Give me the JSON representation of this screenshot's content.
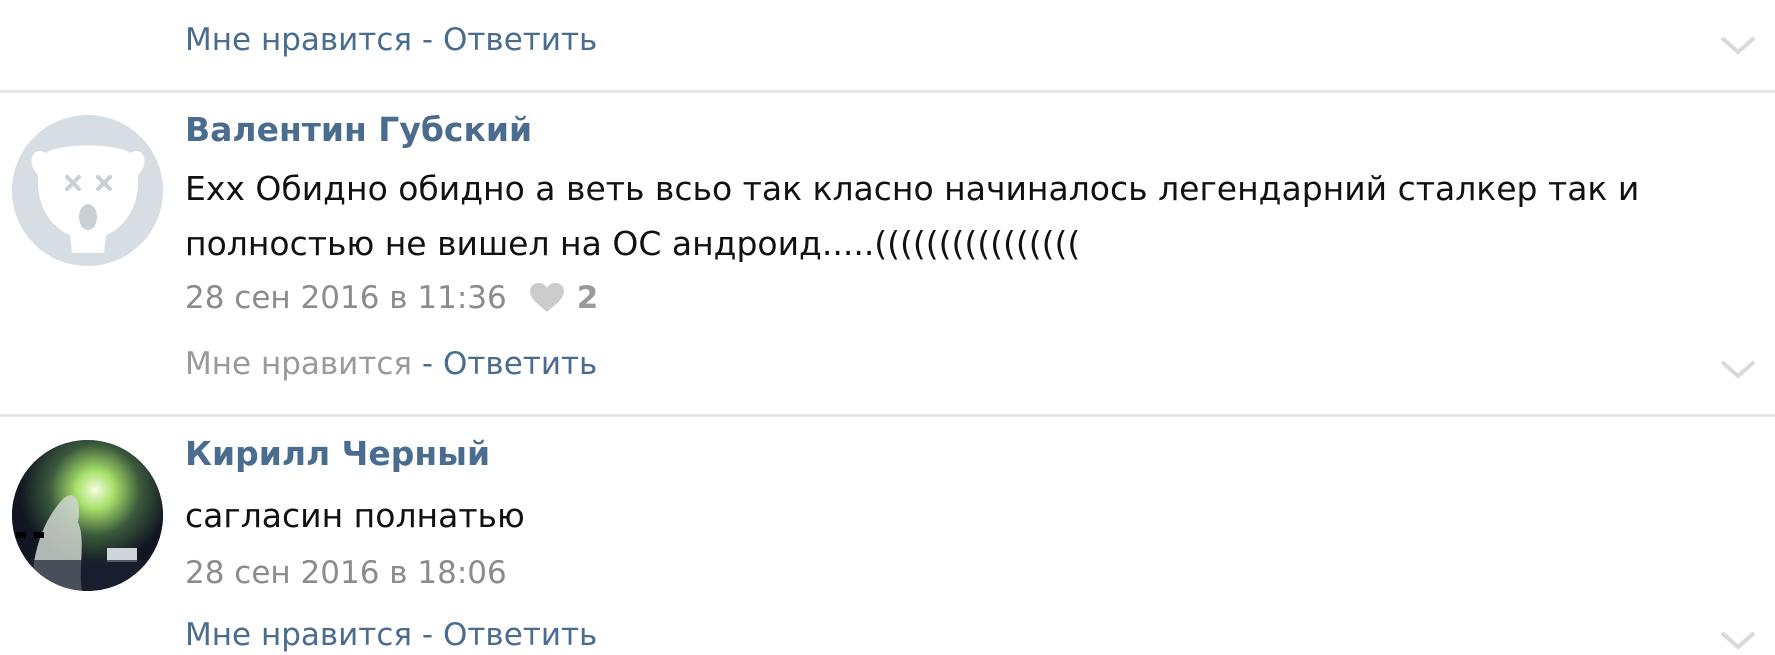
{
  "top_item": {
    "like_label": "Мне нравится",
    "separator": " - ",
    "reply_label": "Ответить"
  },
  "comments": [
    {
      "author": "Валентин Губский",
      "text": "Exx Обидно обидно а веть всьо так класно начиналось легендарний сталкер так и полностью не вишел на ОС андроид.....((((((((((((((((",
      "date": "28 сен 2016 в 11:36",
      "likes": "2",
      "like_label": "Мне нравится",
      "separator": " - ",
      "reply_label": "Ответить"
    },
    {
      "author": "Кирилл Черный",
      "text": "сагласин полнатью",
      "date": "28 сен 2016 в 18:06",
      "like_label": "Мне нравится",
      "separator": " - ",
      "reply_label": "Ответить"
    }
  ],
  "icons": {
    "chevron": "chevron-down-icon",
    "heart": "heart-icon",
    "default_avatar": "vk-dog-avatar-icon"
  },
  "colors": {
    "link": "#4a6d8f",
    "muted": "#8c8c8c",
    "divider": "#e6e6e6",
    "avatar_default_bg": "#d6dde3"
  }
}
